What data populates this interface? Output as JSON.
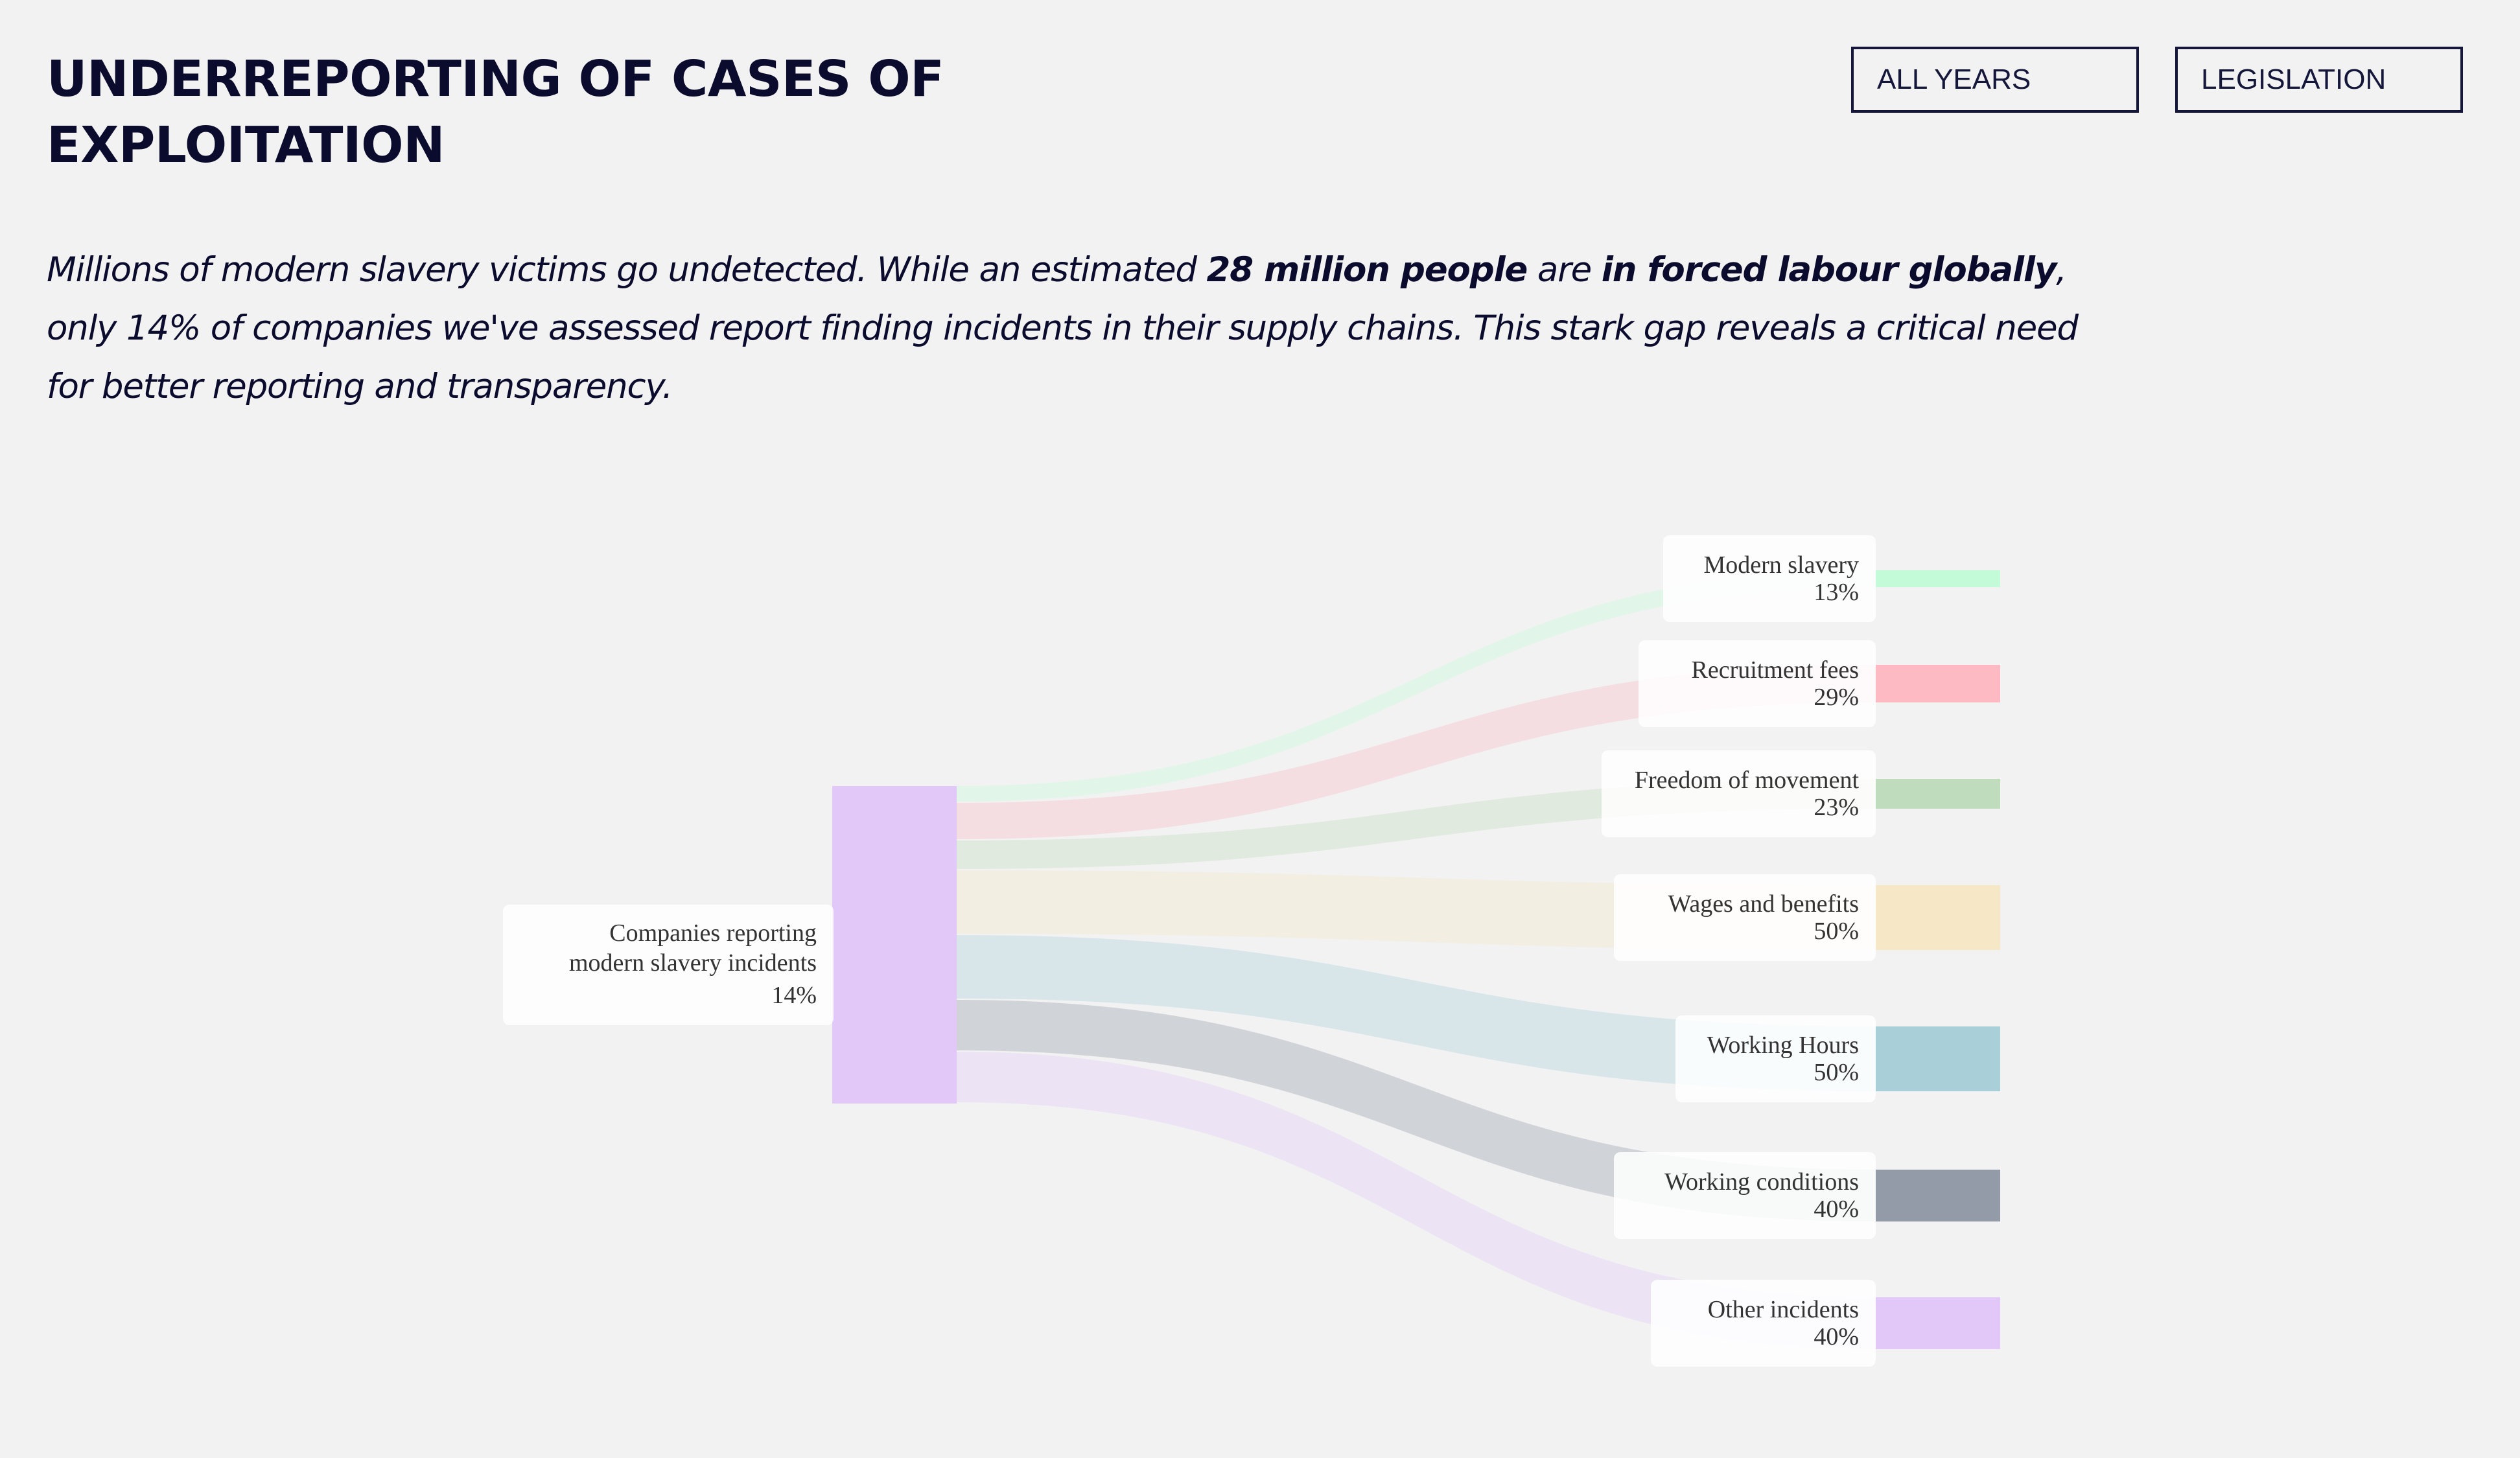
{
  "header": {
    "title_line1": "UNDERREPORTING OF CASES OF",
    "title_line2": "EXPLOITATION",
    "filters": {
      "years": "ALL YEARS",
      "category": "LEGISLATION"
    }
  },
  "intro": {
    "part1": "Millions of modern slavery victims go undetected. While an estimated ",
    "bold1": "28 million people",
    "part2": " are ",
    "bold2": "in forced labour globally",
    "part3": ", only 14% of companies we've assessed report finding incidents in their supply chains. This stark gap reveals a critical need for better reporting and transparency."
  },
  "chart_data": {
    "type": "sankey",
    "source": {
      "label_line1": "Companies reporting",
      "label_line2": "modern slavery incidents",
      "value_label": "14%",
      "value": 14,
      "color": "#e2c8f8"
    },
    "targets": [
      {
        "name": "Modern slavery",
        "value": 13,
        "value_label": "13%",
        "color": "#c3fbd9"
      },
      {
        "name": "Recruitment fees",
        "value": 29,
        "value_label": "29%",
        "color": "#fdbac2"
      },
      {
        "name": "Freedom of movement",
        "value": 23,
        "value_label": "23%",
        "color": "#bfdcbd"
      },
      {
        "name": "Wages and benefits",
        "value": 50,
        "value_label": "50%",
        "color": "#f6e7c6"
      },
      {
        "name": "Working Hours",
        "value": 50,
        "value_label": "50%",
        "color": "#a9d0d9"
      },
      {
        "name": "Working conditions",
        "value": 40,
        "value_label": "40%",
        "color": "#939ba8"
      },
      {
        "name": "Other incidents",
        "value": 40,
        "value_label": "40%",
        "color": "#e2c8f8"
      }
    ]
  }
}
